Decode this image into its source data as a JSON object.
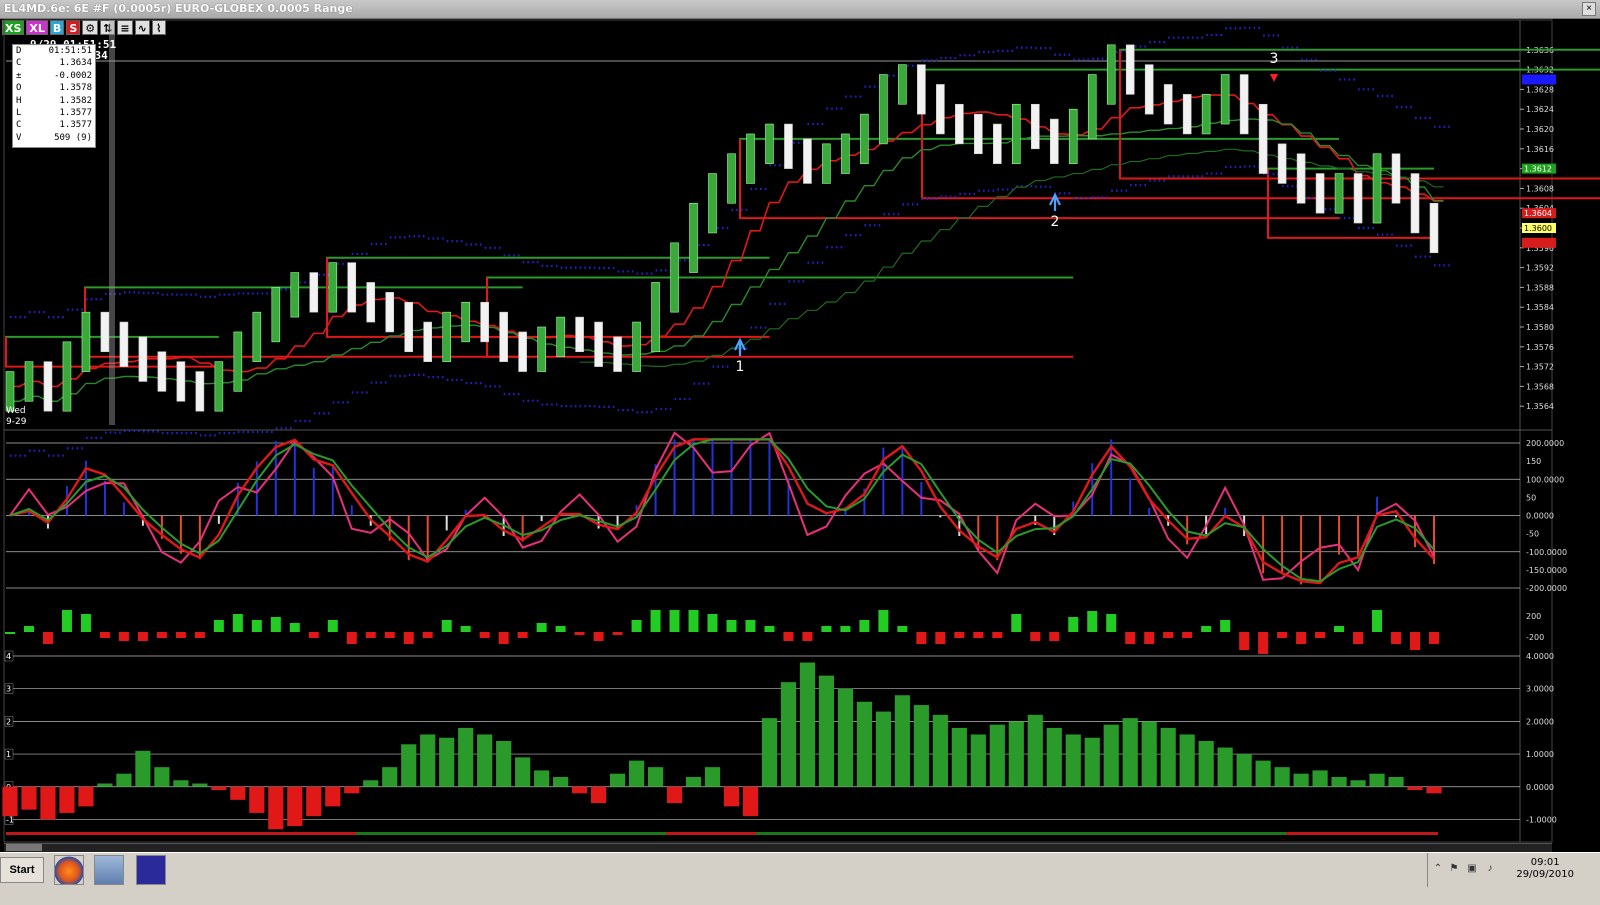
{
  "window": {
    "title": "EL4MD.6e: 6E #F (0.0005r) EURO-GLOBEX 0.0005 Range",
    "close": "×"
  },
  "toolbar": [
    {
      "label": "XS",
      "bg": "#1fa01f",
      "fg": "#ffffff"
    },
    {
      "label": "XL",
      "bg": "#cc33cc",
      "fg": "#ffffff"
    },
    {
      "label": "B",
      "bg": "#2aa7d8",
      "fg": "#ffffff"
    },
    {
      "label": "S",
      "bg": "#d61c1c",
      "fg": "#ffffff"
    },
    {
      "label": "⚙",
      "bg": "#e0e0e0",
      "fg": "#000000"
    },
    {
      "label": "⇅",
      "bg": "#e0e0e0",
      "fg": "#000000"
    },
    {
      "label": "≡",
      "bg": "#e0e0e0",
      "fg": "#000000"
    },
    {
      "label": "∿",
      "bg": "#e0e0e0",
      "fg": "#000000"
    },
    {
      "label": "⌇",
      "bg": "#e0e0e0",
      "fg": "#000000"
    }
  ],
  "cursor": {
    "time": "9/29 01:51:51",
    "price": "1.3634"
  },
  "readout": [
    {
      "k": "D",
      "v": "01:51:51"
    },
    {
      "k": "C",
      "v": "1.3634"
    },
    {
      "k": "±",
      "v": "-0.0002"
    },
    {
      "k": "O",
      "v": "1.3578"
    },
    {
      "k": "H",
      "v": "1.3582"
    },
    {
      "k": "L",
      "v": "1.3577"
    },
    {
      "k": "C",
      "v": "1.3577"
    },
    {
      "k": "V",
      "v": "509 (9)"
    }
  ],
  "day_label": {
    "day": "Wed",
    "date": "9-29"
  },
  "chart_data": {
    "type": "line",
    "price_axis": {
      "ticks": [
        "1.3636",
        "1.3632",
        "1.3628",
        "1.3624",
        "1.3620",
        "1.3616",
        "1.3612",
        "1.3608",
        "1.3604",
        "1.3600",
        "1.3596",
        "1.3592",
        "1.3588",
        "1.3584",
        "1.3580",
        "1.3576",
        "1.3572",
        "1.3568",
        "1.3564"
      ],
      "range": [
        1.356,
        1.364
      ],
      "tags": [
        {
          "price": 1.363,
          "label": "",
          "color": "#1a1aff"
        },
        {
          "price": 1.3612,
          "label": "1.3612",
          "color": "#1fa01f"
        },
        {
          "price": 1.3603,
          "label": "1.3604",
          "color": "#d61c1c"
        },
        {
          "price": 1.36,
          "label": "1.3600",
          "color": "#ffff66"
        },
        {
          "price": 1.3597,
          "label": "",
          "color": "#d61c1c"
        }
      ]
    },
    "close": [
      1.3568,
      1.357,
      1.3566,
      1.3574,
      1.358,
      1.3578,
      1.3575,
      1.3572,
      1.357,
      1.3568,
      1.3566,
      1.357,
      1.3576,
      1.358,
      1.3585,
      1.3588,
      1.3586,
      1.359,
      1.3586,
      1.3584,
      1.3582,
      1.3578,
      1.3576,
      1.358,
      1.3582,
      1.358,
      1.3576,
      1.3574,
      1.3577,
      1.3579,
      1.3578,
      1.3575,
      1.3574,
      1.3578,
      1.3586,
      1.3594,
      1.3602,
      1.3608,
      1.3612,
      1.3616,
      1.3618,
      1.3615,
      1.3612,
      1.3614,
      1.3616,
      1.362,
      1.3628,
      1.363,
      1.3626,
      1.3622,
      1.362,
      1.3618,
      1.3616,
      1.3622,
      1.3619,
      1.3616,
      1.3621,
      1.3628,
      1.3634,
      1.363,
      1.3626,
      1.3624,
      1.3622,
      1.3624,
      1.3628,
      1.3622,
      1.3614,
      1.3612,
      1.3608,
      1.3606,
      1.3608,
      1.3604,
      1.3612,
      1.3608,
      1.3602,
      1.3598
    ],
    "annotations": [
      {
        "label": "1",
        "color": "#4aa3ff"
      },
      {
        "label": "2",
        "color": "#4aa3ff"
      },
      {
        "label": "3",
        "color": "#ff2020"
      }
    ],
    "cci_axis": [
      "200.0000",
      "150",
      "100.0000",
      "50",
      "0.0000",
      "-50",
      "-100.0000",
      "-150.0000",
      "-200.0000"
    ],
    "volume_axis": [
      "200",
      "-200"
    ],
    "delta_axis": [
      "4.0000",
      "3.0000",
      "2.0000",
      "1.0000",
      "0.0000",
      "-1.0000"
    ],
    "delta_left_axis": [
      "4",
      "3",
      "2",
      "1",
      "0",
      "-1"
    ],
    "delta": [
      -0.9,
      -0.7,
      -1.0,
      -0.8,
      -0.6,
      0.1,
      0.4,
      1.1,
      0.6,
      0.2,
      0.1,
      -0.1,
      -0.4,
      -0.8,
      -1.3,
      -1.2,
      -0.9,
      -0.6,
      -0.2,
      0.2,
      0.6,
      1.3,
      1.6,
      1.5,
      1.8,
      1.6,
      1.4,
      0.9,
      0.5,
      0.3,
      -0.2,
      -0.5,
      0.4,
      0.8,
      0.6,
      -0.5,
      0.3,
      0.6,
      -0.6,
      -0.9,
      2.1,
      3.2,
      3.8,
      3.4,
      3.0,
      2.6,
      2.3,
      2.8,
      2.5,
      2.2,
      1.8,
      1.6,
      1.9,
      2.0,
      2.2,
      1.8,
      1.6,
      1.5,
      1.9,
      2.1,
      2.0,
      1.8,
      1.6,
      1.4,
      1.2,
      1.0,
      0.8,
      0.6,
      0.4,
      0.5,
      0.3,
      0.2,
      0.4,
      0.3,
      -0.1,
      -0.2
    ]
  },
  "taskbar": {
    "start": "Start",
    "time": "09:01",
    "date": "29/09/2010"
  }
}
